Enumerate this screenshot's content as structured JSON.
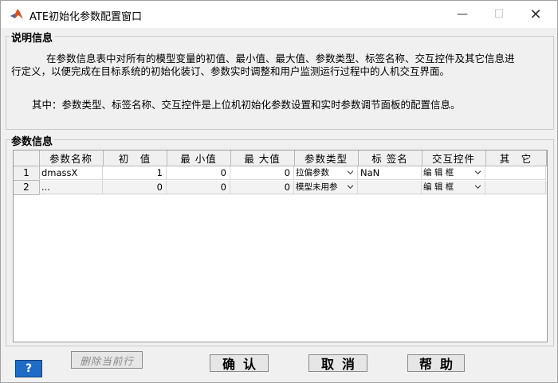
{
  "window": {
    "title": "ATE初始化参数配置窗口",
    "minimize_glyph": "—",
    "maximize_glyph": "☐",
    "close_glyph": "✕"
  },
  "description": {
    "group_title": "说明信息",
    "paragraph1": "在参数信息表中对所有的模型变量的初值、最小值、最大值、参数类型、标签名称、交互控件及其它信息进行定义，以便完成在目标系统的初始化装订、参数实时调整和用户监测运行过程中的人机交互界面。",
    "paragraph2": "其中：参数类型、标签名称、交互控件是上位机初始化参数设置和实时参数调节面板的配置信息。"
  },
  "params": {
    "group_title": "参数信息",
    "columns": [
      "参数名称",
      "初　值",
      "最 小值",
      "最 大值",
      "参数类型",
      "标 签名",
      "交互控件",
      "其　它"
    ],
    "rows": [
      {
        "index": "1",
        "name": "dmassX",
        "init": "1",
        "min": "0",
        "max": "0",
        "type": "拉偏参数",
        "label": "NaN",
        "control": "编 辑 框",
        "other": ""
      },
      {
        "index": "2",
        "name": "...",
        "init": "0",
        "min": "0",
        "max": "0",
        "type": "模型未用参",
        "label": "",
        "control": "编 辑 框",
        "other": ""
      }
    ]
  },
  "buttons": {
    "delete_row": "删除当前行",
    "help_q": "?",
    "confirm": "确认",
    "cancel": "取消",
    "help": "帮助"
  },
  "colors": {
    "help_button": "#1f6cc7",
    "window_bg": "#f0f0f0"
  }
}
